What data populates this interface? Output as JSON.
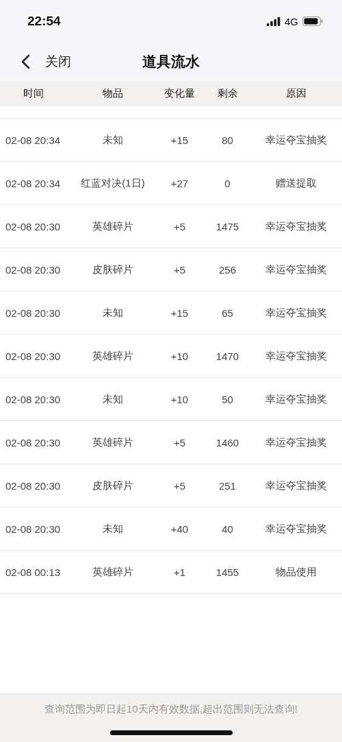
{
  "status_bar": {
    "time": "22:54",
    "network": "4G"
  },
  "nav": {
    "back_label": "关闭",
    "title": "道具流水"
  },
  "table": {
    "columns": [
      "时间",
      "物品",
      "变化量",
      "剩余",
      "原因"
    ],
    "rows": [
      [
        "02-08 20:34",
        "未知",
        "+15",
        "80",
        "幸运夺宝抽奖"
      ],
      [
        "02-08 20:34",
        "红蓝对决(1日)",
        "+27",
        "0",
        "赠送提取"
      ],
      [
        "02-08 20:30",
        "英雄碎片",
        "+5",
        "1475",
        "幸运夺宝抽奖"
      ],
      [
        "02-08 20:30",
        "皮肤碎片",
        "+5",
        "256",
        "幸运夺宝抽奖"
      ],
      [
        "02-08 20:30",
        "未知",
        "+15",
        "65",
        "幸运夺宝抽奖"
      ],
      [
        "02-08 20:30",
        "英雄碎片",
        "+10",
        "1470",
        "幸运夺宝抽奖"
      ],
      [
        "02-08 20:30",
        "未知",
        "+10",
        "50",
        "幸运夺宝抽奖"
      ],
      [
        "02-08 20:30",
        "英雄碎片",
        "+5",
        "1460",
        "幸运夺宝抽奖"
      ],
      [
        "02-08 20:30",
        "皮肤碎片",
        "+5",
        "251",
        "幸运夺宝抽奖"
      ],
      [
        "02-08 20:30",
        "未知",
        "+40",
        "40",
        "幸运夺宝抽奖"
      ],
      [
        "02-08 00:13",
        "英雄碎片",
        "+1",
        "1455",
        "物品使用"
      ]
    ]
  },
  "footer": {
    "notice": "查询范围为即日起10天内有效数据,超出范围则无法查询!"
  }
}
